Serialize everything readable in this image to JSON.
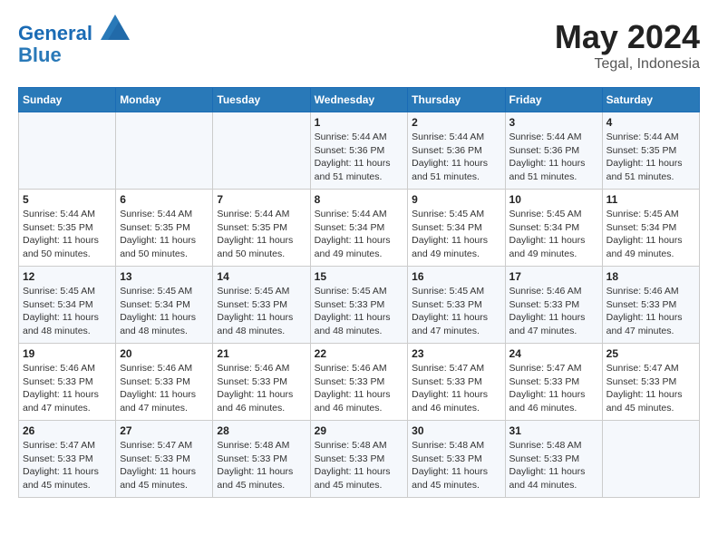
{
  "header": {
    "logo_line1": "General",
    "logo_line2": "Blue",
    "month_year": "May 2024",
    "location": "Tegal, Indonesia"
  },
  "weekdays": [
    "Sunday",
    "Monday",
    "Tuesday",
    "Wednesday",
    "Thursday",
    "Friday",
    "Saturday"
  ],
  "weeks": [
    [
      {
        "day": "",
        "info": ""
      },
      {
        "day": "",
        "info": ""
      },
      {
        "day": "",
        "info": ""
      },
      {
        "day": "1",
        "info": "Sunrise: 5:44 AM\nSunset: 5:36 PM\nDaylight: 11 hours\nand 51 minutes."
      },
      {
        "day": "2",
        "info": "Sunrise: 5:44 AM\nSunset: 5:36 PM\nDaylight: 11 hours\nand 51 minutes."
      },
      {
        "day": "3",
        "info": "Sunrise: 5:44 AM\nSunset: 5:36 PM\nDaylight: 11 hours\nand 51 minutes."
      },
      {
        "day": "4",
        "info": "Sunrise: 5:44 AM\nSunset: 5:35 PM\nDaylight: 11 hours\nand 51 minutes."
      }
    ],
    [
      {
        "day": "5",
        "info": "Sunrise: 5:44 AM\nSunset: 5:35 PM\nDaylight: 11 hours\nand 50 minutes."
      },
      {
        "day": "6",
        "info": "Sunrise: 5:44 AM\nSunset: 5:35 PM\nDaylight: 11 hours\nand 50 minutes."
      },
      {
        "day": "7",
        "info": "Sunrise: 5:44 AM\nSunset: 5:35 PM\nDaylight: 11 hours\nand 50 minutes."
      },
      {
        "day": "8",
        "info": "Sunrise: 5:44 AM\nSunset: 5:34 PM\nDaylight: 11 hours\nand 49 minutes."
      },
      {
        "day": "9",
        "info": "Sunrise: 5:45 AM\nSunset: 5:34 PM\nDaylight: 11 hours\nand 49 minutes."
      },
      {
        "day": "10",
        "info": "Sunrise: 5:45 AM\nSunset: 5:34 PM\nDaylight: 11 hours\nand 49 minutes."
      },
      {
        "day": "11",
        "info": "Sunrise: 5:45 AM\nSunset: 5:34 PM\nDaylight: 11 hours\nand 49 minutes."
      }
    ],
    [
      {
        "day": "12",
        "info": "Sunrise: 5:45 AM\nSunset: 5:34 PM\nDaylight: 11 hours\nand 48 minutes."
      },
      {
        "day": "13",
        "info": "Sunrise: 5:45 AM\nSunset: 5:34 PM\nDaylight: 11 hours\nand 48 minutes."
      },
      {
        "day": "14",
        "info": "Sunrise: 5:45 AM\nSunset: 5:33 PM\nDaylight: 11 hours\nand 48 minutes."
      },
      {
        "day": "15",
        "info": "Sunrise: 5:45 AM\nSunset: 5:33 PM\nDaylight: 11 hours\nand 48 minutes."
      },
      {
        "day": "16",
        "info": "Sunrise: 5:45 AM\nSunset: 5:33 PM\nDaylight: 11 hours\nand 47 minutes."
      },
      {
        "day": "17",
        "info": "Sunrise: 5:46 AM\nSunset: 5:33 PM\nDaylight: 11 hours\nand 47 minutes."
      },
      {
        "day": "18",
        "info": "Sunrise: 5:46 AM\nSunset: 5:33 PM\nDaylight: 11 hours\nand 47 minutes."
      }
    ],
    [
      {
        "day": "19",
        "info": "Sunrise: 5:46 AM\nSunset: 5:33 PM\nDaylight: 11 hours\nand 47 minutes."
      },
      {
        "day": "20",
        "info": "Sunrise: 5:46 AM\nSunset: 5:33 PM\nDaylight: 11 hours\nand 47 minutes."
      },
      {
        "day": "21",
        "info": "Sunrise: 5:46 AM\nSunset: 5:33 PM\nDaylight: 11 hours\nand 46 minutes."
      },
      {
        "day": "22",
        "info": "Sunrise: 5:46 AM\nSunset: 5:33 PM\nDaylight: 11 hours\nand 46 minutes."
      },
      {
        "day": "23",
        "info": "Sunrise: 5:47 AM\nSunset: 5:33 PM\nDaylight: 11 hours\nand 46 minutes."
      },
      {
        "day": "24",
        "info": "Sunrise: 5:47 AM\nSunset: 5:33 PM\nDaylight: 11 hours\nand 46 minutes."
      },
      {
        "day": "25",
        "info": "Sunrise: 5:47 AM\nSunset: 5:33 PM\nDaylight: 11 hours\nand 45 minutes."
      }
    ],
    [
      {
        "day": "26",
        "info": "Sunrise: 5:47 AM\nSunset: 5:33 PM\nDaylight: 11 hours\nand 45 minutes."
      },
      {
        "day": "27",
        "info": "Sunrise: 5:47 AM\nSunset: 5:33 PM\nDaylight: 11 hours\nand 45 minutes."
      },
      {
        "day": "28",
        "info": "Sunrise: 5:48 AM\nSunset: 5:33 PM\nDaylight: 11 hours\nand 45 minutes."
      },
      {
        "day": "29",
        "info": "Sunrise: 5:48 AM\nSunset: 5:33 PM\nDaylight: 11 hours\nand 45 minutes."
      },
      {
        "day": "30",
        "info": "Sunrise: 5:48 AM\nSunset: 5:33 PM\nDaylight: 11 hours\nand 45 minutes."
      },
      {
        "day": "31",
        "info": "Sunrise: 5:48 AM\nSunset: 5:33 PM\nDaylight: 11 hours\nand 44 minutes."
      },
      {
        "day": "",
        "info": ""
      }
    ]
  ]
}
